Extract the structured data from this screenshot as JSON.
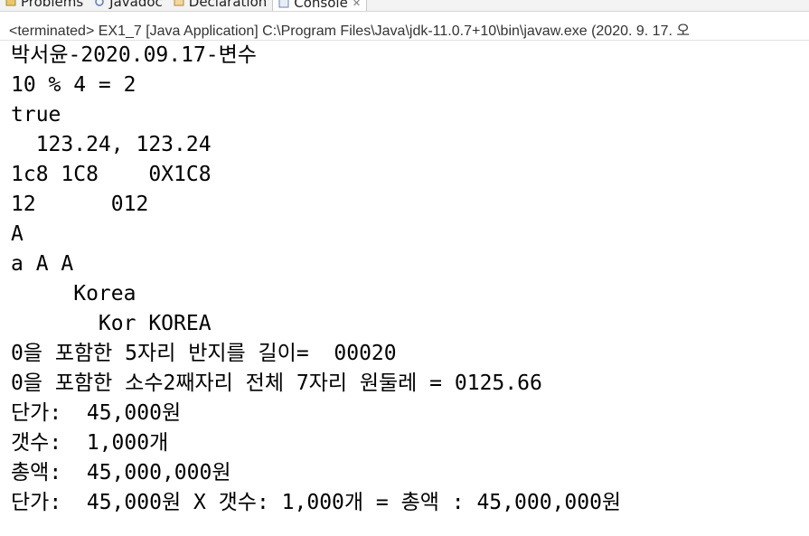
{
  "tabs": [
    {
      "label": "Problems",
      "icon": "problems-icon",
      "active": false
    },
    {
      "label": "Javadoc",
      "icon": "javadoc-icon",
      "active": false
    },
    {
      "label": "Declaration",
      "icon": "declaration-icon",
      "active": false
    },
    {
      "label": "Console",
      "icon": "console-icon",
      "active": true,
      "close": "✕"
    }
  ],
  "status": {
    "text": "<terminated> EX1_7 [Java Application] C:\\Program Files\\Java\\jdk-11.0.7+10\\bin\\javaw.exe  (2020. 9. 17. 오"
  },
  "console": {
    "lines": [
      "박서윤-2020.09.17-변수",
      "10 % 4 = 2",
      "true",
      "  123.24, 123.24",
      "1c8 1C8    0X1C8",
      "12      012",
      "A",
      "a A A",
      "     Korea",
      "       Kor KOREA",
      "0을 포함한 5자리 반지를 길이=  00020",
      "0을 포함한 소수2째자리 전체 7자리 원둘레 = 0125.66",
      "단가:  45,000원",
      "갯수:  1,000개",
      "총액:  45,000,000원",
      "단가:  45,000원 X 갯수: 1,000개 = 총액 : 45,000,000원"
    ]
  },
  "colors": {
    "background": "#ffffff",
    "text": "#000000",
    "tab_active_border": "#5a8ad6"
  }
}
